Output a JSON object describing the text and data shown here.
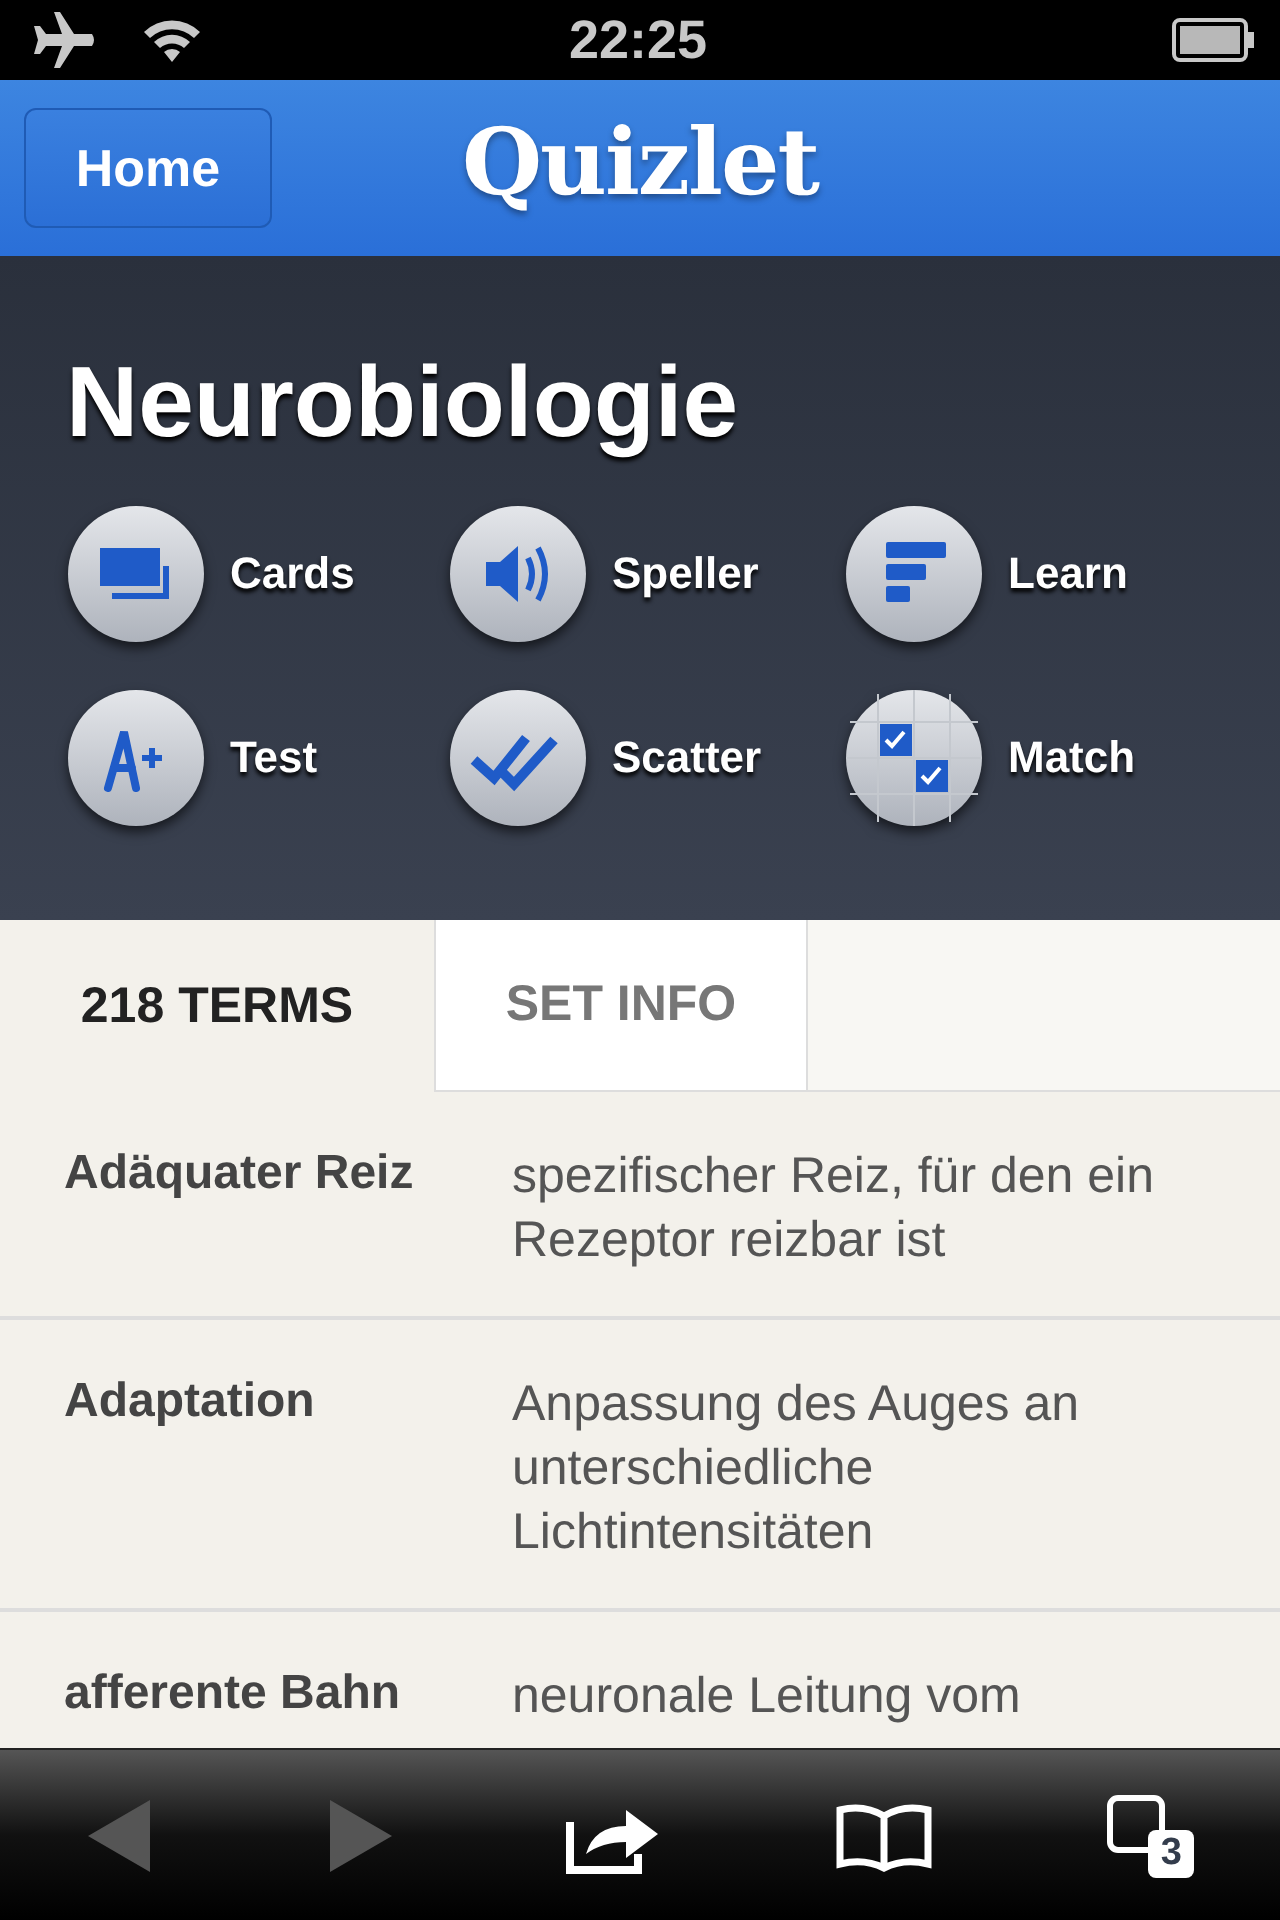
{
  "status_bar": {
    "time": "22:25"
  },
  "nav": {
    "button": "Home",
    "logo": "Quizlet"
  },
  "set": {
    "title": "Neurobiologie",
    "modes": [
      {
        "kind": "cards",
        "label": "Cards"
      },
      {
        "kind": "speller",
        "label": "Speller"
      },
      {
        "kind": "learn",
        "label": "Learn"
      },
      {
        "kind": "test",
        "label": "Test"
      },
      {
        "kind": "scatter",
        "label": "Scatter"
      },
      {
        "kind": "match",
        "label": "Match"
      }
    ]
  },
  "tabs": [
    {
      "label": "218 TERMS",
      "selected": true
    },
    {
      "label": "SET INFO",
      "selected": false
    }
  ],
  "terms": [
    {
      "term": "Adäquater Reiz",
      "definition": "spezifischer Reiz, für den ein Rezeptor reizbar ist"
    },
    {
      "term": "Adaptation",
      "definition": "Anpassung des Auges an unterschiedliche Lichtintensitäten"
    },
    {
      "term": "afferente Bahn",
      "definition": "neuronale Leitung vom"
    }
  ],
  "toolbar": {
    "back_disabled": true,
    "forward_disabled": true,
    "tab_count": "3"
  }
}
